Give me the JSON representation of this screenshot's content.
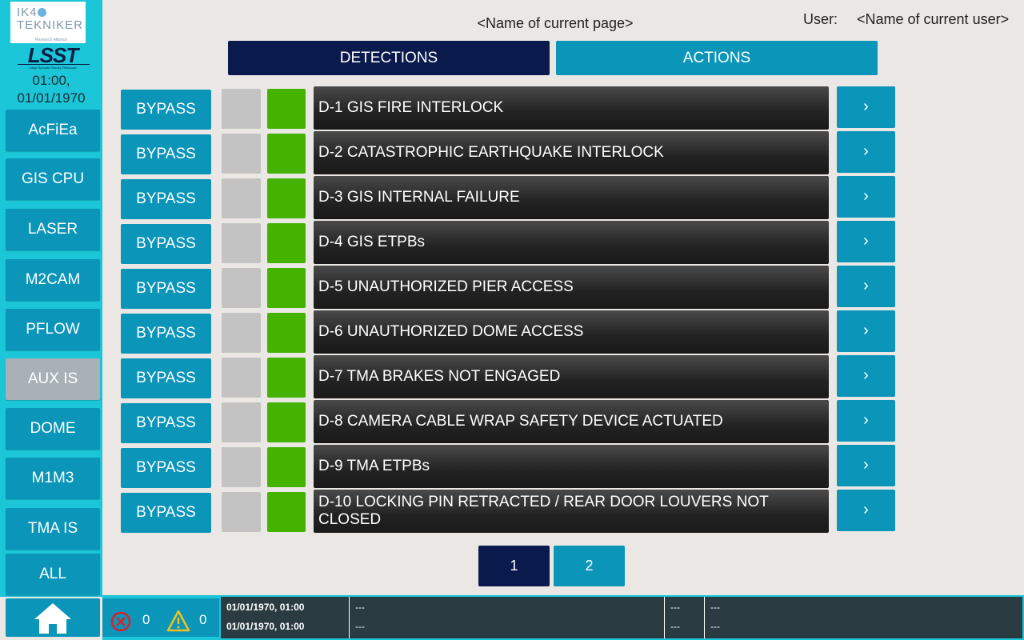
{
  "header": {
    "page_title": "<Name of current page>",
    "user_label": "User:",
    "user_name": "<Name of current user>"
  },
  "logos": {
    "ik4_text": "IK4",
    "tekniker_text": "TEKNIKER",
    "tekniker_sub": "Research Alliance",
    "lsst_text": "LSST",
    "lsst_caption": "Large Synoptic Survey Telescope"
  },
  "clock": {
    "time": "01:00,",
    "date": "01/01/1970"
  },
  "sidebar": {
    "items": [
      {
        "label": "AcFiEa",
        "selected": false
      },
      {
        "label": "GIS CPU",
        "selected": false
      },
      {
        "label": "LASER",
        "selected": false
      },
      {
        "label": "M2CAM",
        "selected": false
      },
      {
        "label": "PFLOW",
        "selected": false
      },
      {
        "label": "AUX IS",
        "selected": true
      },
      {
        "label": "DOME",
        "selected": false
      },
      {
        "label": "M1M3",
        "selected": false
      },
      {
        "label": "TMA IS",
        "selected": false
      },
      {
        "label": "ALL",
        "selected": false
      }
    ],
    "home_icon": "home-icon"
  },
  "tabs": {
    "detections": "DETECTIONS",
    "actions": "ACTIONS",
    "active": "detections"
  },
  "rows": [
    {
      "bypass": "BYPASS",
      "label": "D-1 GIS FIRE INTERLOCK",
      "goto": "›"
    },
    {
      "bypass": "BYPASS",
      "label": "D-2 CATASTROPHIC EARTHQUAKE INTERLOCK",
      "goto": "›"
    },
    {
      "bypass": "BYPASS",
      "label": "D-3 GIS INTERNAL FAILURE",
      "goto": "›"
    },
    {
      "bypass": "BYPASS",
      "label": "D-4 GIS ETPBs",
      "goto": "›"
    },
    {
      "bypass": "BYPASS",
      "label": "D-5 UNAUTHORIZED PIER ACCESS",
      "goto": "›"
    },
    {
      "bypass": "BYPASS",
      "label": "D-6 UNAUTHORIZED DOME ACCESS",
      "goto": "›"
    },
    {
      "bypass": "BYPASS",
      "label": "D-7 TMA BRAKES NOT ENGAGED",
      "goto": "›"
    },
    {
      "bypass": "BYPASS",
      "label": "D-8 CAMERA CABLE WRAP SAFETY DEVICE ACTUATED",
      "goto": "›"
    },
    {
      "bypass": "BYPASS",
      "label": "D-9 TMA ETPBs",
      "goto": "›"
    },
    {
      "bypass": "BYPASS",
      "label": "D-10 LOCKING PIN RETRACTED / REAR DOOR LOUVERS NOT CLOSED",
      "goto": "›"
    }
  ],
  "colors": {
    "indicator_left": "#c3c3c3",
    "indicator_right": "#44b300",
    "accent": "#0a95b9",
    "navy": "#0b1a4c"
  },
  "pagination": {
    "pages": [
      "1",
      "2"
    ],
    "current": "1"
  },
  "footer": {
    "error_icon": "error-circle-icon",
    "error_count": "0",
    "warning_icon": "warning-triangle-icon",
    "warning_count": "0",
    "log": [
      {
        "timestamp": "01/01/1970, 01:00",
        "message": "---",
        "code": "---",
        "detail": "---"
      },
      {
        "timestamp": "01/01/1970, 01:00",
        "message": "---",
        "code": "---",
        "detail": "---"
      }
    ]
  }
}
